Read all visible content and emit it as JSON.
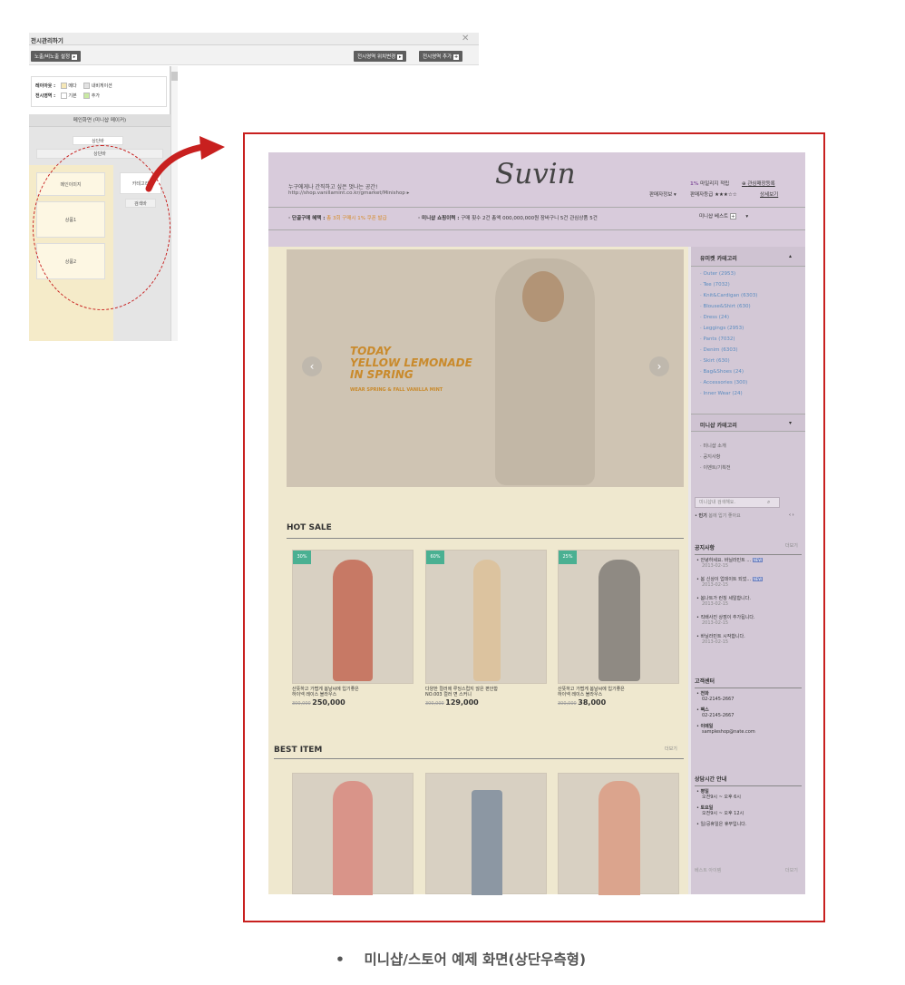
{
  "admin": {
    "title": "전시관리하기",
    "toggle_btn": "노출/비노출 설정",
    "btn_edit_area": "전시영역 위치변경",
    "btn_add_area": "전시영역 추가",
    "legend": {
      "layout_label": "레이아웃 :",
      "layout_opt1": "메다",
      "layout_opt2": "내비게이션",
      "area_label": "전시영역 :",
      "area_opt1": "기본",
      "area_opt2": "추가"
    },
    "mini_title": "메인화면 (미니샵 메이커)",
    "mini_btn1": "상단바",
    "mini_btn2": "상단바",
    "block_main_image": "메인이미지",
    "block_category": "카테고리",
    "block_search": "검색바",
    "block_product1": "상품1",
    "block_product2": "상품2",
    "plus": "+"
  },
  "shop": {
    "slogan": "누구에게나 간직하고 싶은 멋나는 공간!",
    "url": "http://shop.vanillamint.co.kr/gmarket/Minishop",
    "logo": "Suvin",
    "review_pct": "1%",
    "review_label": "마일리지 적립",
    "favorite": "관심매장등록",
    "seller_info": "판매자정보",
    "seller_grade": "판매자등급",
    "stars": "★★★☆☆",
    "detail": "상세보기",
    "benefit_label": "· 단골구매 혜택 :",
    "benefit_text": "총 3회 구매시 1% 쿠폰 발급",
    "status_label": "· 미니샵 쇼핑이력 :",
    "status_text": "구매 횟수 2건   총액 000,000,000원   장바구니 5건   관심상품 5건",
    "best_menu": "미니샵 베스트",
    "hero_line1": "TODAY",
    "hero_line2": "YELLOW LEMONADE",
    "hero_line3": "IN SPRING",
    "hero_sub": "WEAR SPRING & FALL VANILLA MINT",
    "hot_sale": "HOT SALE",
    "best_item": "BEST ITEM",
    "more": "더보기",
    "products": [
      {
        "badge": "30%",
        "name1": "산뜻하고 가볍게 봄날씨에 입기좋은",
        "name2": "하이넥 레이스 블라우스",
        "old": "300,000",
        "price": "250,000"
      },
      {
        "badge": "60%",
        "name1": "다양한 컬러에 루딩스럽지 않은 편안함",
        "name2": "NO.003 컬러 면 스커니",
        "old": "300,000",
        "price": "129,000"
      },
      {
        "badge": "25%",
        "name1": "산뜻하고 가볍게 봄날씨에 입기좋은",
        "name2": "하이넥 레이스 블라우스",
        "old": "300,000",
        "price": "38,000"
      }
    ],
    "side": {
      "cat_title": "유미켓 카테고리",
      "categories": [
        "Outer (2953)",
        "Tee (7032)",
        "Knit&Cardigan (6303)",
        "Blouse&Shirt (630)",
        "Dress (24)",
        "Leggings (2953)",
        "Pants (7032)",
        "Denim (6303)",
        "Skirt (630)",
        "Bag&Shoes (24)",
        "Accessories (300)",
        "Inner Wear (24)"
      ],
      "mini_cat_title": "미니샵 카테고리",
      "mini_links": [
        "미니샵 소개",
        "공지사항",
        "이벤트/기획전"
      ],
      "search_ph": "미니샵내 검색해요.",
      "popular_label": "인기",
      "popular_text": "봄에 입기 좋아요",
      "notice_title": "공지사항",
      "notices": [
        {
          "t": "안녕하세요. 바닐라민트 ...",
          "d": "2013-02-15"
        },
        {
          "t": "봄 신상이 업데이트 되었...",
          "d": "2013-02-15"
        },
        {
          "t": "봄나트가 런칭 세일합니다.",
          "d": "2013-02-15"
        },
        {
          "t": "직배사진 상점이 추가됩니다.",
          "d": "2013-02-15"
        },
        {
          "t": "바닐라민트 시작합니다.",
          "d": "2013-02-15"
        }
      ],
      "new_badge": "NEW",
      "cs_title": "고객센터",
      "cs": [
        {
          "k": "전화",
          "v": "02-2145-2667"
        },
        {
          "k": "팩스",
          "v": "02-2145-2667"
        },
        {
          "k": "이메일",
          "v": "sampleshop@nate.com"
        }
      ],
      "hours_title": "상담시간 안내",
      "hours": [
        {
          "k": "평일",
          "v": "오전9시 ~ 오후 6시"
        },
        {
          "k": "토요일",
          "v": "오전9시 ~ 오후 12시"
        },
        {
          "k": "일/공휴일은 휴무입니다.",
          "v": ""
        }
      ],
      "bottom_label": "베스트 아이템"
    }
  },
  "caption": "미니샵/스토어 예제 화면(상단우측형)",
  "colors": {
    "accent_red": "#c8201f",
    "tag_green": "#4ab092"
  }
}
